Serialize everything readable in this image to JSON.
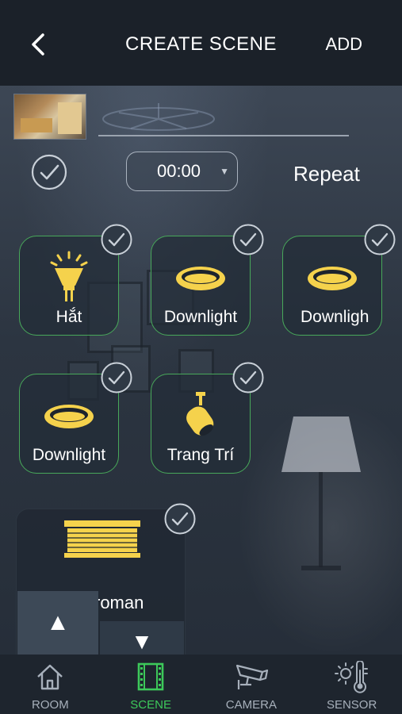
{
  "header": {
    "title": "CREATE SCENE",
    "add_label": "ADD"
  },
  "scene": {
    "name_value": "",
    "time": "00:00",
    "repeat_label": "Repeat"
  },
  "devices": [
    {
      "label": "Hắt",
      "icon": "spotlight-bulb-icon",
      "checked": true
    },
    {
      "label": "Downlight",
      "icon": "downlight-icon",
      "checked": true
    },
    {
      "label": "Downligh",
      "icon": "downlight-icon",
      "checked": true
    },
    {
      "label": "Downlight",
      "icon": "downlight-icon",
      "checked": true
    },
    {
      "label": "Trang Trí",
      "icon": "track-light-icon",
      "checked": true
    }
  ],
  "blind": {
    "label": "roman",
    "icon": "roman-blind-icon",
    "up_symbol": "▲",
    "down_symbol": "▼"
  },
  "tabs": [
    {
      "label": "ROOM",
      "icon": "home-icon",
      "active": false
    },
    {
      "label": "SCENE",
      "icon": "film-icon",
      "active": true
    },
    {
      "label": "CAMERA",
      "icon": "cctv-camera-icon",
      "active": false
    },
    {
      "label": "SENSOR",
      "icon": "thermometer-sun-icon",
      "active": false
    }
  ],
  "colors": {
    "accent_green": "#3dc95a",
    "icon_yellow": "#f5d24c",
    "header_bg": "#1b2129"
  }
}
